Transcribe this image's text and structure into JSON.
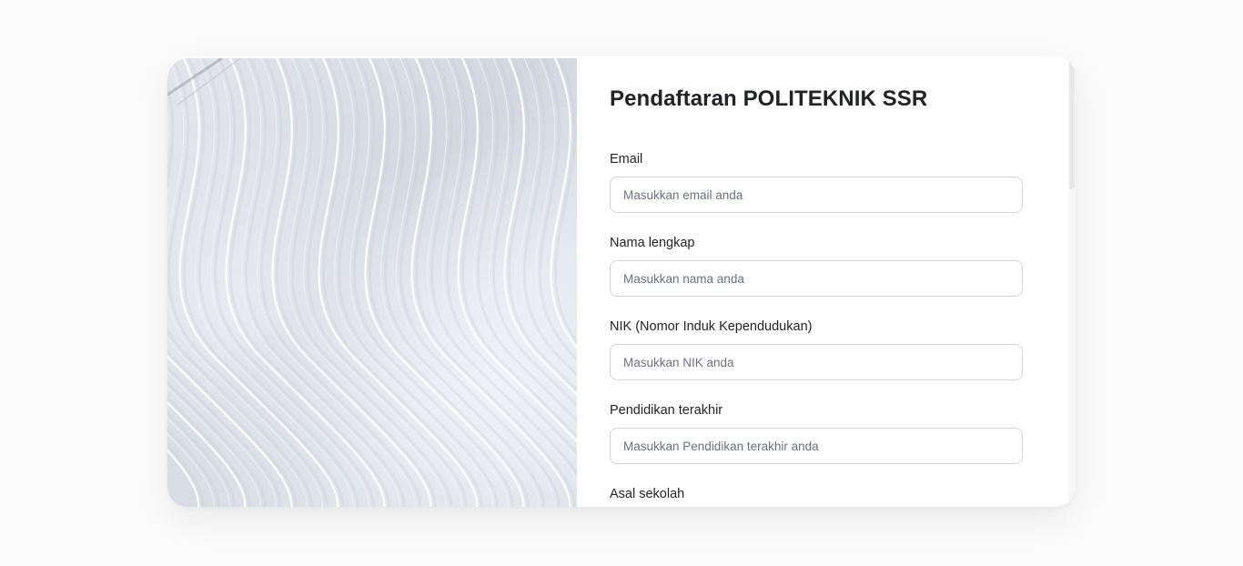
{
  "form": {
    "title": "Pendaftaran POLITEKNIK SSR",
    "fields": [
      {
        "label": "Email",
        "placeholder": "Masukkan email anda",
        "value": ""
      },
      {
        "label": "Nama lengkap",
        "placeholder": "Masukkan nama anda",
        "value": ""
      },
      {
        "label": "NIK (Nomor Induk Kependudukan)",
        "placeholder": "Masukkan NIK anda",
        "value": ""
      },
      {
        "label": "Pendidikan terakhir",
        "placeholder": "Masukkan Pendidikan terakhir anda",
        "value": ""
      },
      {
        "label": "Asal sekolah"
      }
    ]
  },
  "colors": {
    "page_background": "#fbfbfb",
    "card_background": "#ffffff",
    "text": "#222327",
    "input_border": "#cfd3d8",
    "placeholder": "#6c7178"
  }
}
